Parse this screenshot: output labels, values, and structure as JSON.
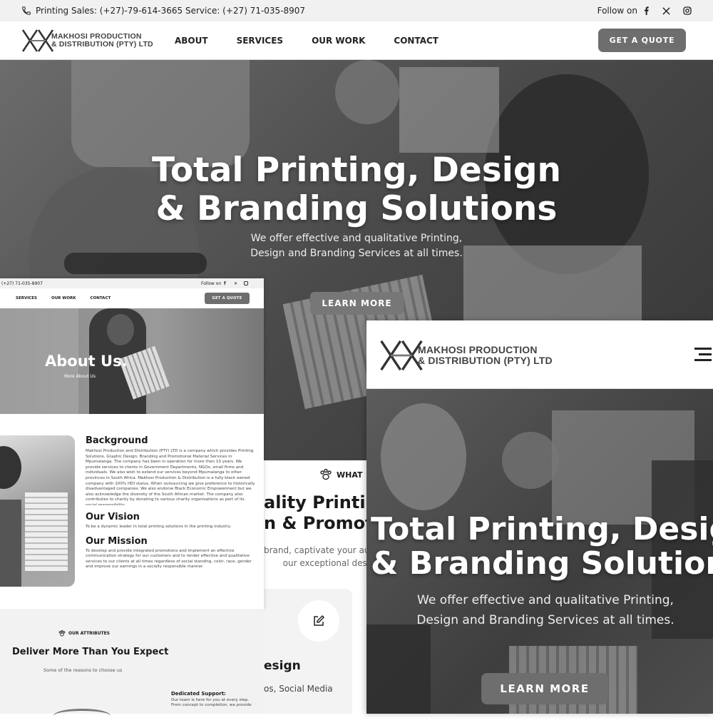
{
  "topbar": {
    "phone_text": "Printing Sales: (+27)-79-614-3665 Service: (+27) 71-035-8907",
    "follow_label": "Follow on"
  },
  "brand": {
    "line1": "MAKHOSI PRODUCTION",
    "line2": "& DISTRIBUTION (PTY) LTD"
  },
  "nav": {
    "items": [
      "ABOUT",
      "SERVICES",
      "OUR WORK",
      "CONTACT"
    ],
    "quote_label": "GET A QUOTE"
  },
  "hero": {
    "title_line1": "Total Printing, Design",
    "title_line2": "& Branding Solutions",
    "subtitle": "We offer effective and qualitative Printing, Design and Branding Services at all times.",
    "button_label": "LEARN MORE"
  },
  "about_page": {
    "topbar_phone": "(+27) 71-035-8907",
    "follow_label": "Follow on",
    "nav_items": [
      "SERVICES",
      "OUR WORK",
      "CONTACT"
    ],
    "quote_label": "GET A QUOTE",
    "title": "About Us.",
    "more_link": "More About Us",
    "background_heading": "Background",
    "background_text": "Makhosi Production and Distribution (PTY) LTD is a company which provides Printing Solutions, Graphic Design, Branding and Promotional Material Services in Mpumalanga. The company has been in operation for more than 10 years. We provide services to clients in Government Departments, NGOs, small firms and individuals. We also wish to extend our services beyond Mpumalanga to other provinces in South Africa. Makhosi Production & Distribution is a fully black owned company with 100% HDI status. When outsourcing we give preference to historically disadvantaged companies. We also endorse Black Economic Empowerment but we also acknowledge the diversity of the South African market. The company also contributes to charity by donating to various charity organisations as part of its social responsibility.",
    "vision_heading": "Our Vision",
    "vision_text": "To be a dynamic leader in total printing solutions in the printing industry.",
    "mission_heading": "Our Mission",
    "mission_text": "To develop and provide integrated promotions and implement an effective communication strategy for our customers and to render effective and qualitative services to our clients at all times regardless of social standing, color, race, gender and improve our earnings in a socially responsible manner."
  },
  "services_partial": {
    "eyebrow": "WHAT",
    "heading_line1": "ality Printin",
    "heading_line2": "n & Promot",
    "text_line1": "brand, captivate your audien",
    "text_line2": "our exceptional design",
    "card_title": "esign",
    "card_text": "os, Social Media"
  },
  "attributes": {
    "eyebrow": "OUR ATTRIBUTES",
    "heading": "Deliver More Than You Expect",
    "sub": "Some of the reasons to choose us",
    "item_title": "Dedicated Support:",
    "item_text_1": "Our team is here for you at every step.",
    "item_text_2": "From concept to completion, we provide"
  },
  "mobile": {
    "title_line1": "Total Printing, Design",
    "title_line2": "& Branding Solutions",
    "subtitle": "We offer effective and qualitative Printing, Design and Branding Services at all times.",
    "button_label": "LEARN MORE"
  },
  "icons": {
    "phone": "phone-icon",
    "facebook": "facebook-icon",
    "x": "x-twitter-icon",
    "instagram": "instagram-icon",
    "menu": "hamburger-menu-icon",
    "edit": "edit-icon",
    "paw": "paw-icon"
  }
}
